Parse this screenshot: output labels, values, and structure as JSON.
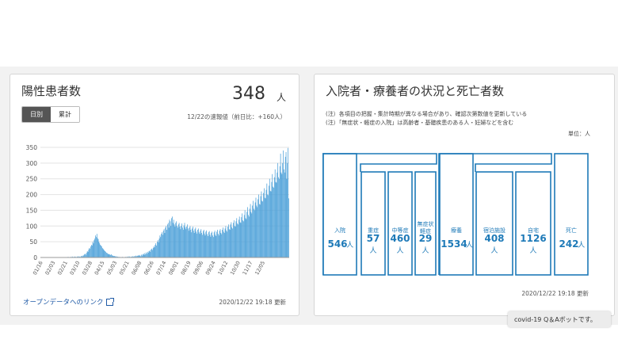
{
  "colors": {
    "accent": "#1e7ab8",
    "bar": "#4a9fd8",
    "text": "#333333",
    "link": "#1f5aa6"
  },
  "positive": {
    "title": "陽性患者数",
    "count": "348",
    "unit": "人",
    "tabs": [
      {
        "label": "日別"
      },
      {
        "label": "累計"
      }
    ],
    "active_tab": "日別",
    "note": "12/22の速報値（前日比：+160人）",
    "link_label": "オープンデータへのリンク",
    "updated": "2020/12/22 19:18 更新"
  },
  "status": {
    "title": "入院者・療養者の状況と死亡者数",
    "notes": [
      "(注）各項目の把握・集計時期が異なる場合があり、確認次第数値を更新している",
      "(注）「無症状・軽症の入院」は高齢者・基礎疾患のある人・妊婦などを含む"
    ],
    "unit_label": "単位：人",
    "unit": "人",
    "updated": "2020/12/22 19:18 更新",
    "boxes": [
      {
        "label": "入院",
        "value": "546"
      },
      {
        "label": "重症",
        "value": "57"
      },
      {
        "label": "中等症",
        "value": "460"
      },
      {
        "label": "無症状\n軽症",
        "value": "29"
      },
      {
        "label": "療養",
        "value": "1534"
      },
      {
        "label": "宿泊施設",
        "value": "408"
      },
      {
        "label": "自宅",
        "value": "1126"
      },
      {
        "label": "死亡",
        "value": "242"
      }
    ]
  },
  "toast": {
    "label": "covid-19 Q＆Aボットです。"
  },
  "chart_data": {
    "type": "bar",
    "title": "",
    "xlabel": "",
    "ylabel": "",
    "ylim": [
      0,
      350
    ],
    "yticks": [
      0,
      50,
      100,
      150,
      200,
      250,
      300,
      350
    ],
    "grid": true,
    "xtick_labels": [
      "01/16",
      "02/03",
      "02/21",
      "03/10",
      "03/28",
      "04/15",
      "05/03",
      "05/21",
      "06/08",
      "06/26",
      "07/14",
      "08/01",
      "08/19",
      "09/06",
      "09/24",
      "10/12",
      "10/30",
      "11/17",
      "12/05"
    ],
    "xtick_day_index": [
      0,
      18,
      36,
      54,
      72,
      90,
      108,
      126,
      144,
      162,
      180,
      198,
      216,
      234,
      252,
      270,
      288,
      306,
      324
    ],
    "series": [
      {
        "values": [
          0,
          0,
          0,
          0,
          0,
          0,
          0,
          0,
          0,
          0,
          0,
          0,
          0,
          0,
          0,
          0,
          0,
          0,
          0,
          0,
          0,
          0,
          0,
          0,
          0,
          0,
          0,
          0,
          0,
          0,
          0,
          0,
          0,
          0,
          0,
          0,
          1,
          0,
          1,
          0,
          2,
          1,
          0,
          1,
          2,
          1,
          3,
          2,
          1,
          2,
          3,
          2,
          1,
          3,
          2,
          4,
          2,
          3,
          2,
          5,
          3,
          6,
          4,
          8,
          10,
          12,
          9,
          15,
          20,
          18,
          25,
          30,
          28,
          35,
          40,
          38,
          50,
          45,
          55,
          60,
          70,
          65,
          75,
          62,
          58,
          50,
          45,
          40,
          38,
          35,
          30,
          28,
          25,
          22,
          20,
          18,
          15,
          14,
          12,
          10,
          11,
          9,
          8,
          10,
          7,
          6,
          5,
          4,
          5,
          3,
          4,
          2,
          3,
          2,
          1,
          2,
          1,
          0,
          1,
          2,
          0,
          1,
          1,
          0,
          2,
          1,
          3,
          1,
          2,
          4,
          2,
          1,
          3,
          2,
          4,
          3,
          2,
          5,
          3,
          6,
          4,
          5,
          7,
          5,
          8,
          6,
          4,
          9,
          6,
          10,
          12,
          8,
          14,
          10,
          16,
          12,
          18,
          15,
          20,
          22,
          18,
          25,
          28,
          24,
          30,
          35,
          32,
          40,
          45,
          38,
          50,
          55,
          48,
          60,
          70,
          65,
          75,
          80,
          72,
          85,
          90,
          78,
          95,
          100,
          88,
          105,
          110,
          95,
          120,
          115,
          100,
          125,
          130,
          110,
          120,
          105,
          98,
          110,
          115,
          100,
          95,
          105,
          110,
          98,
          90,
          100,
          108,
          95,
          88,
          102,
          110,
          96,
          90,
          98,
          105,
          92,
          85,
          95,
          100,
          88,
          80,
          92,
          98,
          85,
          78,
          90,
          95,
          82,
          76,
          88,
          92,
          80,
          75,
          85,
          90,
          78,
          72,
          84,
          88,
          76,
          70,
          82,
          86,
          74,
          68,
          80,
          84,
          72,
          66,
          78,
          82,
          70,
          65,
          80,
          85,
          72,
          68,
          82,
          88,
          75,
          70,
          85,
          90,
          78,
          74,
          88,
          95,
          82,
          78,
          92,
          100,
          86,
          82,
          98,
          105,
          90,
          88,
          105,
          112,
          96,
          92,
          110,
          118,
          100,
          98,
          115,
          125,
          108,
          105,
          120,
          130,
          112,
          110,
          128,
          140,
          118,
          115,
          135,
          150,
          125,
          122,
          145,
          160,
          135,
          130,
          155,
          170,
          145,
          140,
          165,
          180,
          155,
          150,
          175,
          190,
          165,
          160,
          185,
          200,
          170,
          168,
          195,
          210,
          180,
          178,
          205,
          220,
          190,
          188,
          215,
          235,
          200,
          198,
          228,
          250,
          212,
          210,
          240,
          265,
          225,
          222,
          255,
          280,
          240,
          238,
          270,
          300,
          255,
          250,
          290,
          330,
          270,
          265,
          300,
          340,
          280,
          270,
          320,
          335,
          250,
          300,
          348,
          188
        ]
      }
    ]
  }
}
